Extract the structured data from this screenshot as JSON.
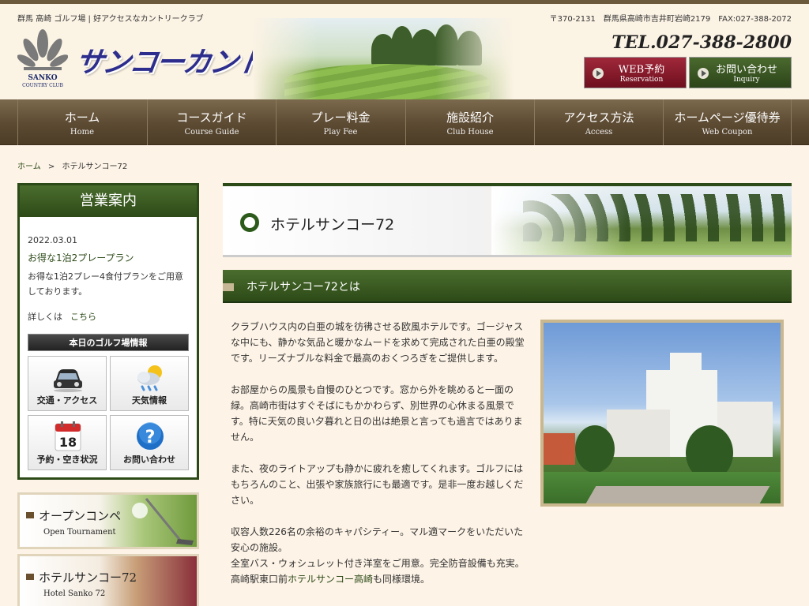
{
  "header": {
    "tagline": "群馬 高崎 ゴルフ場 | 好アクセスなカントリークラブ",
    "address": "〒370-2131　群馬県高崎市吉井町岩崎2179　FAX:027-388-2072",
    "logo_en_line1": "SANKO",
    "logo_en_line2": "COUNTRY CLUB",
    "logo_jp": "サンコーカントリークラブ",
    "tel": "TEL.027-388-2800",
    "web_reserve": {
      "main": "WEB予約",
      "sub": "Reservation"
    },
    "inquiry": {
      "main": "お問い合わせ",
      "sub": "Inquiry"
    }
  },
  "nav": [
    {
      "jp": "ホーム",
      "en": "Home"
    },
    {
      "jp": "コースガイド",
      "en": "Course Guide"
    },
    {
      "jp": "プレー料金",
      "en": "Play Fee"
    },
    {
      "jp": "施設紹介",
      "en": "Club House"
    },
    {
      "jp": "アクセス方法",
      "en": "Access"
    },
    {
      "jp": "ホームページ優待券",
      "en": "Web Coupon"
    }
  ],
  "breadcrumb": {
    "home": "ホーム",
    "sep": ">",
    "current": "ホテルサンコー72"
  },
  "sidebar": {
    "title": "営業案内",
    "news_date": "2022.03.01",
    "news_title": "お得な1泊2プレープラン",
    "news_body": "お得な1泊2プレー4食付プランをご用意しております。",
    "more_label": "詳しくは",
    "more_link": "こちら",
    "golf_info": "本日のゴルフ場情報",
    "tiles": [
      "交通・アクセス",
      "天気情報",
      "予約・空き状況",
      "お問い合わせ"
    ],
    "calendar_day": "18"
  },
  "banners": [
    {
      "jp": "オープンコンペ",
      "en": "Open Tournament"
    },
    {
      "jp": "ホテルサンコー72",
      "en": "Hotel Sanko 72"
    }
  ],
  "main": {
    "page_title": "ホテルサンコー72",
    "section_title": "ホテルサンコー72とは",
    "p1": "クラブハウス内の白亜の城を彷彿させる欧風ホテルです。ゴージャスな中にも、静かな気品と暖かなムードを求めて完成された白亜の殿堂です。リーズナブルな料金で最高のおくつろぎをご提供します。",
    "p2": "お部屋からの風景も自慢のひとつです。窓から外を眺めると一面の緑。高崎市街はすぐそばにもかかわらず、別世界の心休まる風景です。特に天気の良い夕暮れと日の出は絶景と言っても過言ではありません。",
    "p3": "また、夜のライトアップも静かに疲れを癒してくれます。ゴルフにはもちろんのこと、出張や家族旅行にも最適です。是非一度お越しください。",
    "p4a": "収容人数226名の余裕のキャパシティー。マル適マークをいただいた安心の施設。",
    "p4b": "全室バス・ウォシュレット付き洋室をご用意。完全防音設備も充実。高崎駅東口前",
    "p4_link": "ホテルサンコー高崎",
    "p4c": "も同様環境。"
  },
  "colors": {
    "brand_green": "#2c4a17",
    "nav_brown": "#5e4c34",
    "reserve_red": "#8a1a2c",
    "bg": "#fdf3e6"
  }
}
